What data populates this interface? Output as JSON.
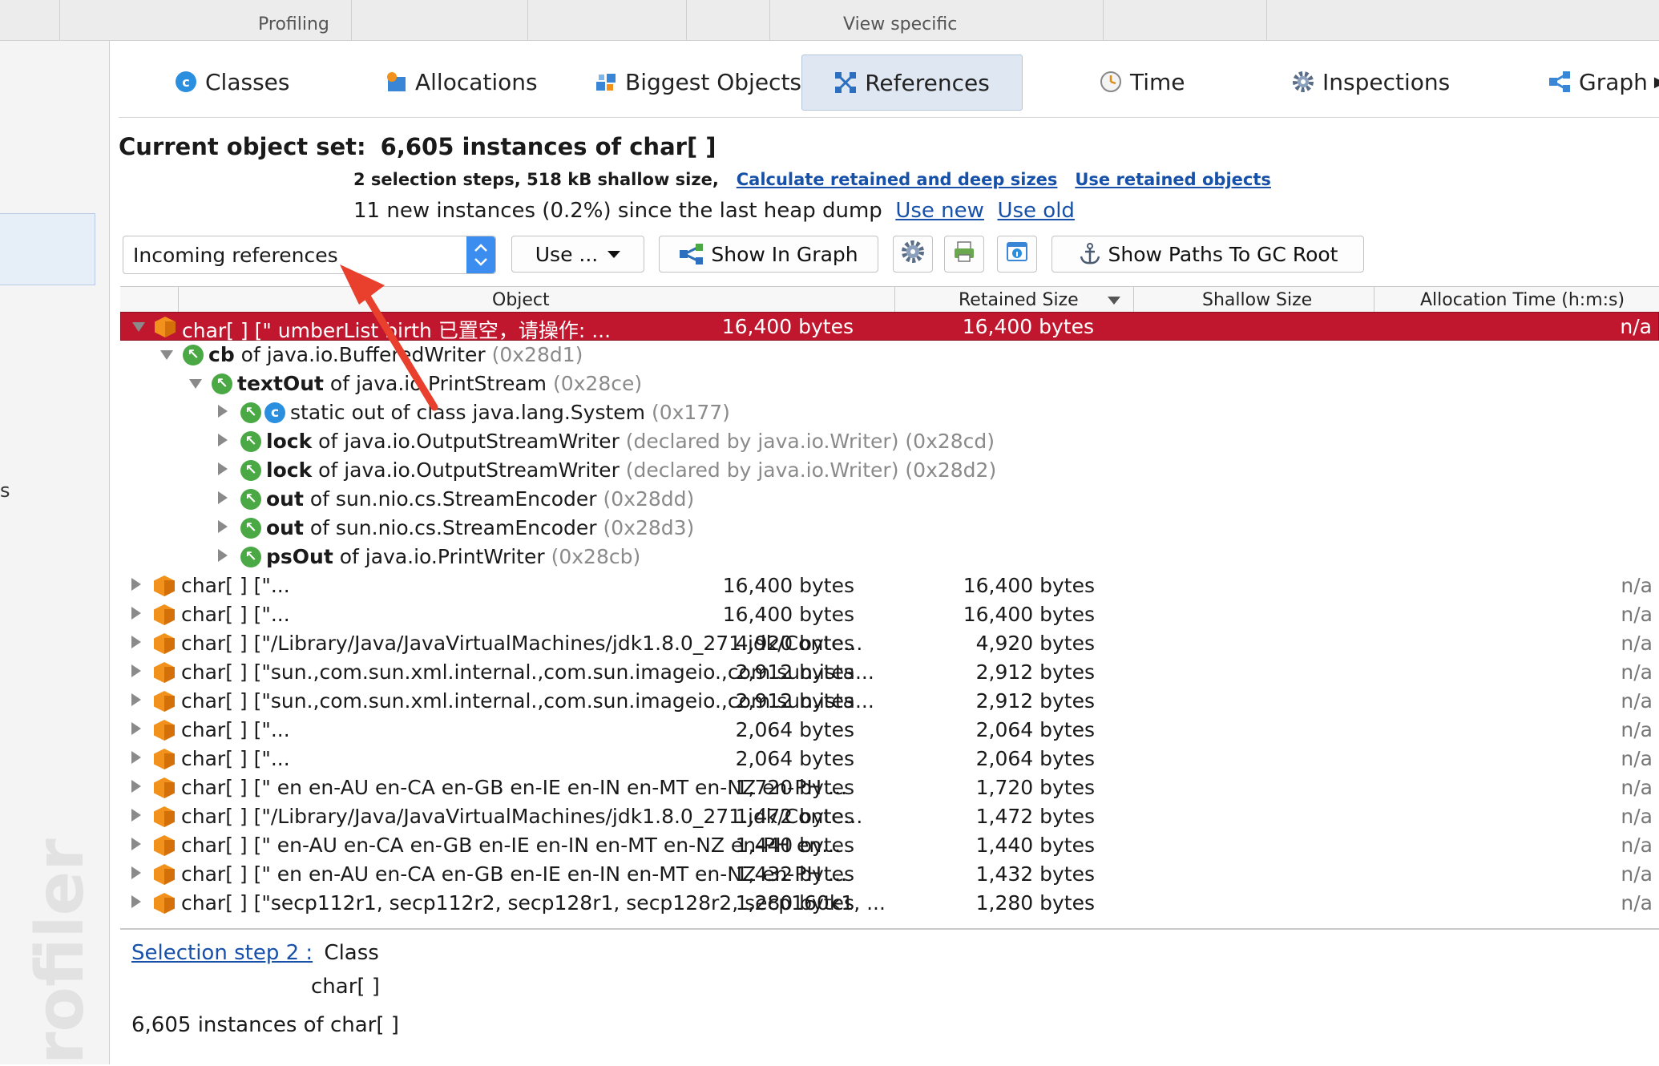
{
  "toolbar": {
    "groups": [
      "Profiling",
      "View specific"
    ]
  },
  "tabs": [
    {
      "label": "Classes",
      "icon": "classes-icon"
    },
    {
      "label": "Allocations",
      "icon": "allocations-icon"
    },
    {
      "label": "Biggest Objects",
      "icon": "biggest-objects-icon"
    },
    {
      "label": "References",
      "icon": "references-icon",
      "active": true
    },
    {
      "label": "Time",
      "icon": "clock-icon"
    },
    {
      "label": "Inspections",
      "icon": "gear-icon"
    },
    {
      "label": "Graph",
      "icon": "graph-icon"
    }
  ],
  "sidebar": {
    "fragment": "s",
    "watermark": "rofiler"
  },
  "header": {
    "title_label": "Current object set:",
    "title_value": "6,605 instances of char[ ]",
    "steps_text": "2 selection steps, 518 kB shallow size,",
    "link_calc": "Calculate retained and deep sizes",
    "link_use_retained": "Use retained objects",
    "new_instances_text": "11 new instances (0.2%) since the last heap dump",
    "link_use_new": "Use new",
    "link_use_old": "Use old"
  },
  "controls": {
    "view_select": "Incoming references",
    "use_button": "Use ...",
    "show_in_graph": "Show In Graph",
    "show_paths": "Show Paths To GC Root"
  },
  "table": {
    "columns": [
      "Object",
      "Retained Size",
      "Shallow Size",
      "Allocation Time (h:m:s)"
    ],
    "rows": [
      {
        "indent": 0,
        "expanded": true,
        "icon": "hex",
        "bold": "",
        "text": "char[ ] [\" umberList  birth 已置空，请操作: ...",
        "gray": "",
        "retained": "16,400 bytes",
        "shallow": "16,400 bytes",
        "time": "n/a",
        "selected": true
      },
      {
        "indent": 1,
        "expanded": true,
        "icon": "ref",
        "bold": "cb",
        "text": " of java.io.BufferedWriter ",
        "gray": "(0x28d1)"
      },
      {
        "indent": 2,
        "expanded": true,
        "icon": "ref",
        "bold": "textOut",
        "text": " of java.io.PrintStream ",
        "gray": "(0x28ce)"
      },
      {
        "indent": 3,
        "expanded": false,
        "icon": "ref-class",
        "bold": "",
        "text": "static out of class java.lang.System ",
        "gray": "(0x177)"
      },
      {
        "indent": 3,
        "expanded": false,
        "icon": "ref",
        "bold": "lock",
        "text": " of java.io.OutputStreamWriter ",
        "gray": "(declared by java.io.Writer) (0x28cd)"
      },
      {
        "indent": 3,
        "expanded": false,
        "icon": "ref",
        "bold": "lock",
        "text": " of java.io.OutputStreamWriter ",
        "gray": "(declared by java.io.Writer) (0x28d2)"
      },
      {
        "indent": 3,
        "expanded": false,
        "icon": "ref",
        "bold": "out",
        "text": " of sun.nio.cs.StreamEncoder ",
        "gray": "(0x28dd)"
      },
      {
        "indent": 3,
        "expanded": false,
        "icon": "ref",
        "bold": "out",
        "text": " of sun.nio.cs.StreamEncoder ",
        "gray": "(0x28d3)"
      },
      {
        "indent": 3,
        "expanded": false,
        "icon": "ref",
        "bold": "psOut",
        "text": " of java.io.PrintWriter ",
        "gray": "(0x28cb)"
      },
      {
        "indent": 0,
        "expanded": false,
        "icon": "hex",
        "bold": "",
        "text": "char[ ] [\"...",
        "gray": "",
        "retained": "16,400 bytes",
        "shallow": "16,400 bytes",
        "time": "n/a"
      },
      {
        "indent": 0,
        "expanded": false,
        "icon": "hex",
        "bold": "",
        "text": "char[ ] [\"...",
        "gray": "",
        "retained": "16,400 bytes",
        "shallow": "16,400 bytes",
        "time": "n/a"
      },
      {
        "indent": 0,
        "expanded": false,
        "icon": "hex",
        "bold": "",
        "text": "char[ ] [\"/Library/Java/JavaVirtualMachines/jdk1.8.0_271.jdk/Conte...",
        "gray": "",
        "retained": "4,920 bytes",
        "shallow": "4,920 bytes",
        "time": "n/a"
      },
      {
        "indent": 0,
        "expanded": false,
        "icon": "hex",
        "bold": "",
        "text": "char[ ] [\"sun.,com.sun.xml.internal.,com.sun.imageio.,com.sun.ista...",
        "gray": "",
        "retained": "2,912 bytes",
        "shallow": "2,912 bytes",
        "time": "n/a"
      },
      {
        "indent": 0,
        "expanded": false,
        "icon": "hex",
        "bold": "",
        "text": "char[ ] [\"sun.,com.sun.xml.internal.,com.sun.imageio.,com.sun.ista...",
        "gray": "",
        "retained": "2,912 bytes",
        "shallow": "2,912 bytes",
        "time": "n/a"
      },
      {
        "indent": 0,
        "expanded": false,
        "icon": "hex",
        "bold": "",
        "text": "char[ ] [\"...",
        "gray": "",
        "retained": "2,064 bytes",
        "shallow": "2,064 bytes",
        "time": "n/a"
      },
      {
        "indent": 0,
        "expanded": false,
        "icon": "hex",
        "bold": "",
        "text": "char[ ] [\"...",
        "gray": "",
        "retained": "2,064 bytes",
        "shallow": "2,064 bytes",
        "time": "n/a"
      },
      {
        "indent": 0,
        "expanded": false,
        "icon": "hex",
        "bold": "",
        "text": "char[ ] [\" en en-AU en-CA en-GB en-IE en-IN en-MT en-NZ en-PH ...",
        "gray": "",
        "retained": "1,720 bytes",
        "shallow": "1,720 bytes",
        "time": "n/a"
      },
      {
        "indent": 0,
        "expanded": false,
        "icon": "hex",
        "bold": "",
        "text": "char[ ] [\"/Library/Java/JavaVirtualMachines/jdk1.8.0_271.jdk/Conte...",
        "gray": "",
        "retained": "1,472 bytes",
        "shallow": "1,472 bytes",
        "time": "n/a"
      },
      {
        "indent": 0,
        "expanded": false,
        "icon": "hex",
        "bold": "",
        "text": "char[ ] [\"  en-AU en-CA en-GB en-IE en-IN en-MT en-NZ en-PH en...",
        "gray": "",
        "retained": "1,440 bytes",
        "shallow": "1,440 bytes",
        "time": "n/a"
      },
      {
        "indent": 0,
        "expanded": false,
        "icon": "hex",
        "bold": "",
        "text": "char[ ] [\"  en en-AU en-CA en-GB en-IE en-IN en-MT en-NZ en-PH ...",
        "gray": "",
        "retained": "1,432 bytes",
        "shallow": "1,432 bytes",
        "time": "n/a"
      },
      {
        "indent": 0,
        "expanded": false,
        "icon": "hex",
        "bold": "",
        "text": "char[ ] [\"secp112r1, secp112r2, secp128r1, secp128r2, secp160k1, ...",
        "gray": "",
        "retained": "1,280 bytes",
        "shallow": "1,280 bytes",
        "time": "n/a"
      }
    ]
  },
  "bottom": {
    "step_link": "Selection step 2 :",
    "step_kind": "Class",
    "step_class": "char[ ]",
    "summary": "6,605 instances of char[ ]"
  },
  "colors": {
    "selection": "#c1172e",
    "link": "#1650a8",
    "accent": "#3b8ef0",
    "annotation_arrow": "#e8402c"
  }
}
